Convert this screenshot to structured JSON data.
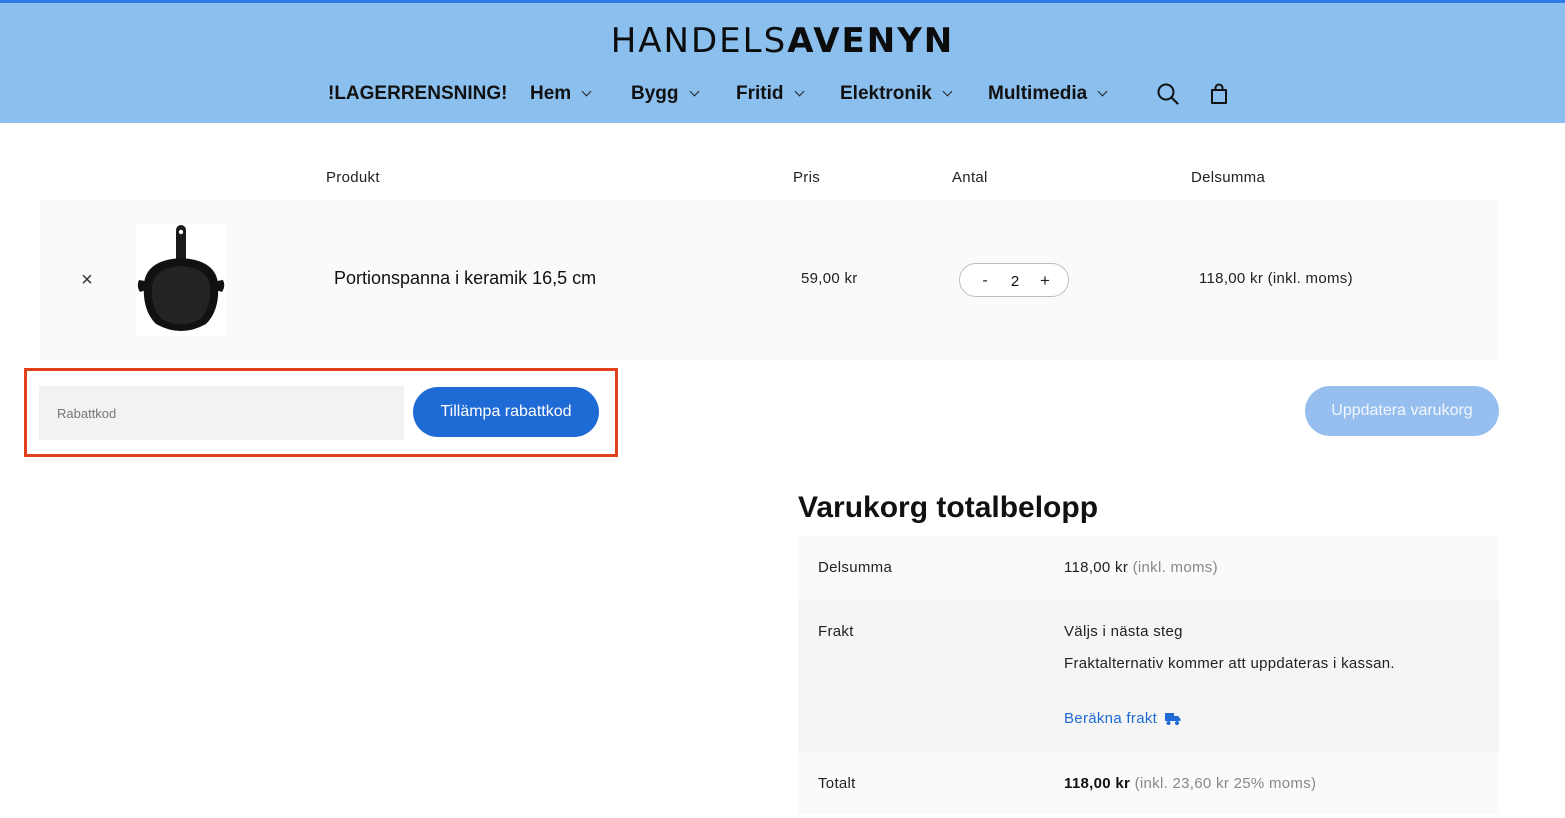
{
  "header": {
    "logo_light": "HANDELS",
    "logo_bold": "AVENYN",
    "nav": [
      {
        "label": "!LAGERRENSNING!",
        "has_dropdown": false
      },
      {
        "label": "Hem",
        "has_dropdown": true
      },
      {
        "label": "Bygg",
        "has_dropdown": true
      },
      {
        "label": "Fritid",
        "has_dropdown": true
      },
      {
        "label": "Elektronik",
        "has_dropdown": true
      },
      {
        "label": "Multimedia",
        "has_dropdown": true
      }
    ],
    "icons": [
      "search-icon",
      "shopping-bag-icon"
    ],
    "background_color": "#8bbfee"
  },
  "cart": {
    "columns": [
      "Produkt",
      "Pris",
      "Antal",
      "Delsumma"
    ],
    "items": [
      {
        "name": "Portionspanna i keramik 16,5 cm",
        "price": "59,00 kr",
        "quantity": "2",
        "subtotal": "118,00 kr (inkl. moms)"
      }
    ],
    "qty_minus": "-",
    "qty_plus": "+",
    "remove_symbol": "×",
    "coupon_placeholder": "Rabattkod",
    "apply_label": "Tillämpa rabattkod",
    "update_label": "Uppdatera varukorg"
  },
  "totals": {
    "title": "Varukorg totalbelopp",
    "subtotal_label": "Delsumma",
    "subtotal_value": "118,00 kr",
    "subtotal_note": "(inkl. moms)",
    "shipping_label": "Frakt",
    "shipping_value": "Väljs i nästa steg",
    "shipping_note": "Fraktalternativ kommer att uppdateras i kassan.",
    "calc_shipping_label": "Beräkna frakt",
    "total_label": "Totalt",
    "total_value": "118,00 kr",
    "total_note": "(inkl. 23,60 kr 25% moms)"
  },
  "colors": {
    "accent": "#1f6bd6",
    "highlight_border": "#e2421a",
    "update_button": "#96bff0"
  }
}
